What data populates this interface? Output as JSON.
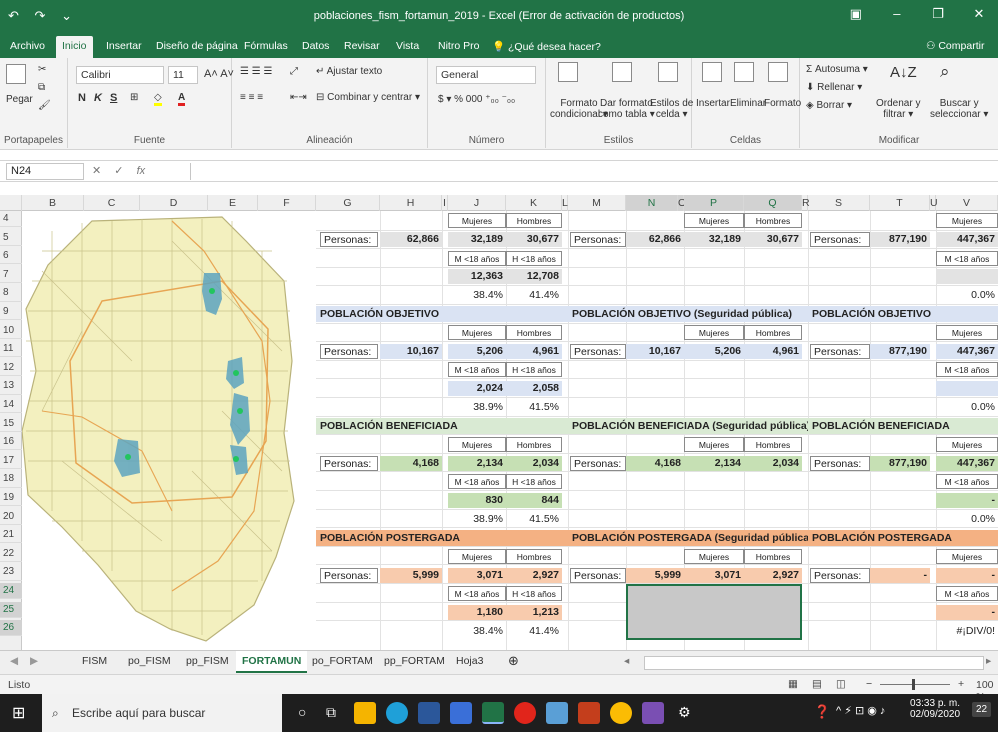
{
  "window": {
    "title": "poblaciones_fism_fortamun_2019 - Excel (Error de activación de productos)"
  },
  "ribbon_tabs": [
    "Archivo",
    "Inicio",
    "Insertar",
    "Diseño de página",
    "Fórmulas",
    "Datos",
    "Revisar",
    "Vista",
    "Nitro Pro"
  ],
  "tell_me": "¿Qué desea hacer?",
  "share": "Compartir",
  "ribbon": {
    "paste": "Pegar",
    "clipboard": "Portapapeles",
    "font_name": "Calibri",
    "font_size": "11",
    "font": "Fuente",
    "wrap_text": "Ajustar texto",
    "merge_center": "Combinar y centrar",
    "alignment": "Alineación",
    "number_format": "General",
    "number": "Número",
    "cond_format_1": "Formato",
    "cond_format_2": "condicional",
    "table_format_1": "Dar formato",
    "table_format_2": "como tabla",
    "cell_styles_1": "Estilos de",
    "cell_styles_2": "celda",
    "styles": "Estilos",
    "insert": "Insertar",
    "delete": "Eliminar",
    "format": "Formato",
    "cells": "Celdas",
    "autosum": "Autosuma",
    "fill": "Rellenar",
    "clear": "Borrar",
    "sort_1": "Ordenar y",
    "sort_2": "filtrar",
    "find_1": "Buscar y",
    "find_2": "seleccionar",
    "editing": "Modificar"
  },
  "name_box": "N24",
  "columns": [
    "B",
    "C",
    "D",
    "E",
    "F",
    "G",
    "H",
    "I",
    "J",
    "K",
    "L",
    "M",
    "N",
    "O",
    "P",
    "Q",
    "R",
    "S",
    "T",
    "U",
    "V"
  ],
  "rows": [
    "4",
    "5",
    "6",
    "7",
    "8",
    "9",
    "10",
    "11",
    "12",
    "13",
    "14",
    "15",
    "16",
    "17",
    "18",
    "19",
    "20",
    "21",
    "22",
    "23",
    "24",
    "25",
    "26"
  ],
  "labels": {
    "personas": "Personas:",
    "mujeres": "Mujeres",
    "hombres": "Hombres",
    "m18": "M <18 años",
    "h18": "H <18 años"
  },
  "sections": {
    "objetivo": "POBLACIÓN OBJETIVO",
    "objetivo_sp": "POBLACIÓN OBJETIVO (Seguridad pública)",
    "beneficiada": "POBLACIÓN BENEFICIADA",
    "beneficiada_sp": "POBLACIÓN BENEFICIADA (Seguridad pública)",
    "postergada": "POBLACIÓN POSTERGADA",
    "postergada_sp": "POBLACIÓN POSTERGADA (Seguridad pública)"
  },
  "values": {
    "top": {
      "h": "62,866",
      "j": "32,189",
      "k": "30,677",
      "n": "62,866",
      "p": "32,189",
      "q": "30,677",
      "t": "877,190",
      "v": "447,367",
      "j7": "12,363",
      "k7": "12,708",
      "j8": "38.4%",
      "k8": "41.4%",
      "v8": "0.0%"
    },
    "objetivo": {
      "h": "10,167",
      "j": "5,206",
      "k": "4,961",
      "n": "10,167",
      "p": "5,206",
      "q": "4,961",
      "t": "877,190",
      "v": "447,367",
      "j13": "2,024",
      "k13": "2,058",
      "j14": "38.9%",
      "k14": "41.5%",
      "v14": "0.0%"
    },
    "beneficiada": {
      "h": "4,168",
      "j": "2,134",
      "k": "2,034",
      "n": "4,168",
      "p": "2,134",
      "q": "2,034",
      "t": "877,190",
      "v": "447,367",
      "j19": "830",
      "k19": "844",
      "v19": "-",
      "j20": "38.9%",
      "k20": "41.5%",
      "v20": "0.0%"
    },
    "postergada": {
      "h": "5,999",
      "j": "3,071",
      "k": "2,927",
      "n": "5,999",
      "p": "3,071",
      "q": "2,927",
      "t": "-",
      "v": "-",
      "j25": "1,180",
      "k25": "1,213",
      "v25": "-",
      "j26": "38.4%",
      "k26": "41.4%",
      "v26": "#¡DIV/0!"
    }
  },
  "sheets": [
    "FISM",
    "po_FISM",
    "pp_FISM",
    "FORTAMUN",
    "po_FORTAM",
    "pp_FORTAM",
    "Hoja3"
  ],
  "active_sheet": "FORTAMUN",
  "status": "Listo",
  "zoom": "100 %",
  "taskbar": {
    "search": "Escribe aquí para buscar",
    "time": "03:33 p. m.",
    "date": "02/09/2020",
    "notifications": "22"
  },
  "colors": {
    "excel_green": "#217346",
    "section_blue": "#dae3f3",
    "section_green": "#d9ead3",
    "section_orange": "#f4b183",
    "value_blue": "#dae3f3",
    "value_green": "#c6e0b4",
    "value_orange": "#f8cbad",
    "map_fill": "#f3f0bf",
    "map_water": "#5da4c0",
    "map_dot": "#22c55e"
  }
}
